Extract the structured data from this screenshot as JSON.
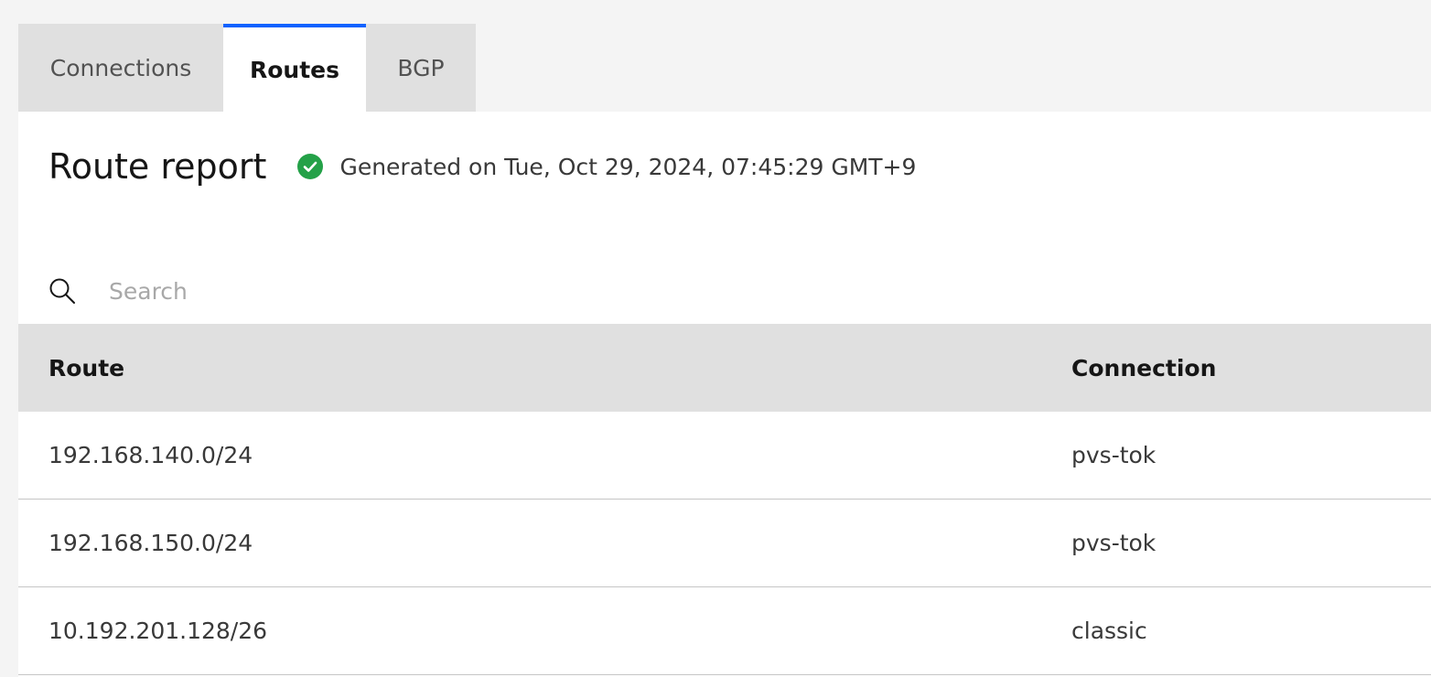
{
  "tabs": [
    {
      "label": "Connections"
    },
    {
      "label": "Routes"
    },
    {
      "label": "BGP"
    }
  ],
  "report": {
    "title": "Route report",
    "status_text": "Generated on Tue, Oct 29, 2024, 07:45:29 GMT+9",
    "status_icon": "checkmark-filled-icon",
    "status_color": "#24a148"
  },
  "search": {
    "placeholder": "Search",
    "value": ""
  },
  "table": {
    "columns": [
      "Route",
      "Connection"
    ],
    "rows": [
      [
        "192.168.140.0/24",
        "pvs-tok"
      ],
      [
        "192.168.150.0/24",
        "pvs-tok"
      ],
      [
        "10.192.201.128/26",
        "classic"
      ]
    ]
  },
  "colors": {
    "accent": "#0f62fe",
    "background": "#f4f4f4",
    "tab_inactive": "#e0e0e0"
  }
}
